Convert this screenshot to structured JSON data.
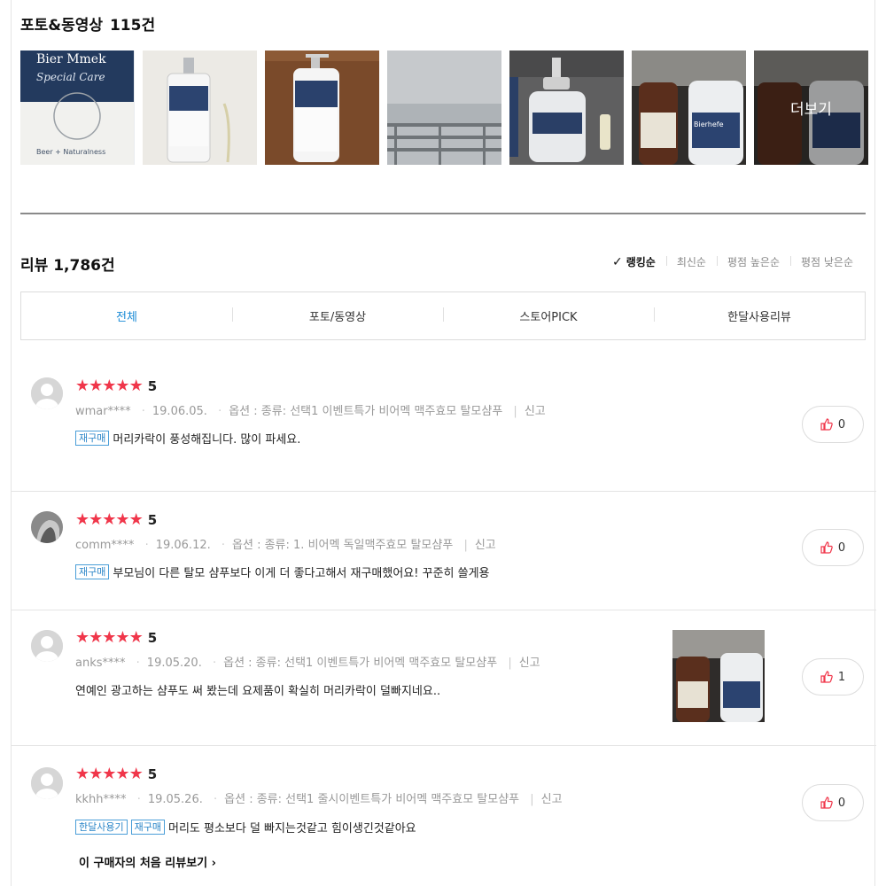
{
  "photo_section": {
    "title": "포토&동영상",
    "count": "115건",
    "more_label": "더보기"
  },
  "reviews_header": {
    "title": "리뷰",
    "count": "1,786건",
    "sorts": [
      "랭킹순",
      "최신순",
      "평점 높은순",
      "평점 낮은순"
    ],
    "active_sort": "랭킹순"
  },
  "tabs": [
    "전체",
    "포토/동영상",
    "스토어PICK",
    "한달사용리뷰"
  ],
  "active_tab": "전체",
  "reviews": [
    {
      "rating": "5",
      "user": "wmar****",
      "date": "19.06.05.",
      "option": "옵션 : 종류: 선택1 이벤트특가 비어멕 맥주효모 탈모샴푸",
      "report": "신고",
      "badges": [
        "재구매"
      ],
      "text": "머리카락이 풍성해집니다. 많이 파세요.",
      "likes": "0"
    },
    {
      "rating": "5",
      "user": "comm****",
      "date": "19.06.12.",
      "option": "옵션 : 종류: 1. 비어멕 독일맥주효모 탈모샴푸",
      "report": "신고",
      "badges": [
        "재구매"
      ],
      "text": "부모님이 다른 탈모 샴푸보다 이게 더 좋다고해서 재구매했어요! 꾸준히 쓸게용",
      "likes": "0"
    },
    {
      "rating": "5",
      "user": "anks****",
      "date": "19.05.20.",
      "option": "옵션 : 종류: 선택1 이벤트특가 비어멕 맥주효모 탈모샴푸",
      "report": "신고",
      "badges": [],
      "text": "연예인 광고하는 샴푸도 써 봤는데 요제품이 확실히 머리카락이 덜빠지네요..",
      "likes": "1"
    },
    {
      "rating": "5",
      "user": "kkhh****",
      "date": "19.05.26.",
      "option": "옵션 : 종류: 선택1 줄시이벤트특가 비어멕 맥주효모 탈모샴푸",
      "report": "신고",
      "badges": [
        "한달사용기",
        "재구매"
      ],
      "text": "머리도 평소보다 덜 빠지는것같고 힘이생긴것같아요",
      "likes": "0",
      "first_review_link": "이 구매자의 처음 리뷰보기"
    }
  ],
  "product_photo_text": {
    "brand_a": "Bier Mmek",
    "line_a": "Special Care",
    "tag_a": "Beer + Naturalness",
    "brand_b": "Bierhefe"
  },
  "colors": {
    "star": "#f0364a",
    "accent": "#1a8bd6",
    "badge": "#2b86c8"
  }
}
